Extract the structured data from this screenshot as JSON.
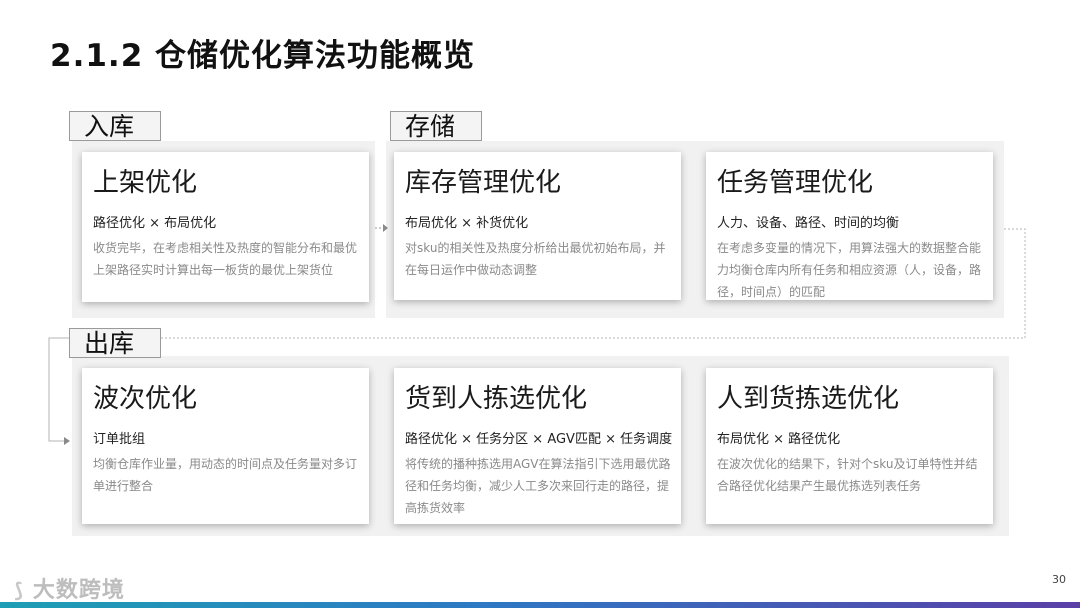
{
  "title": "2.1.2 仓储优化算法功能概览",
  "sections": {
    "inbound": "入库",
    "storage": "存储",
    "outbound": "出库"
  },
  "cards": {
    "putaway": {
      "title": "上架优化",
      "subtitle": "路径优化 × 布局优化",
      "desc": "收货完毕，在考虑相关性及热度的智能分布和最优上架路径实时计算出每一板货的最优上架货位"
    },
    "inventory": {
      "title": "库存管理优化",
      "subtitle": "布局优化 × 补货优化",
      "desc": "对sku的相关性及热度分析给出最优初始布局，并在每日运作中做动态调整"
    },
    "task": {
      "title": "任务管理优化",
      "subtitle": "人力、设备、路径、时间的均衡",
      "desc": "在考虑多变量的情况下，用算法强大的数据整合能力均衡仓库内所有任务和相应资源（人，设备，路径，时间点）的匹配"
    },
    "wave": {
      "title": "波次优化",
      "subtitle": "订单批组",
      "desc": "均衡仓库作业量，用动态的时间点及任务量对多订单进行整合"
    },
    "g2p": {
      "title": "货到人拣选优化",
      "subtitle": "路径优化 × 任务分区 × AGV匹配 × 任务调度",
      "desc": "将传统的播种拣选用AGV在算法指引下选用最优路径和任务均衡，减少人工多次来回行走的路径，提高拣货效率"
    },
    "p2g": {
      "title": "人到货拣选优化",
      "subtitle": "布局优化 × 路径优化",
      "desc": "在波次优化的结果下，针对个sku及订单特性并结合路径优化结果产生最优拣选列表任务"
    }
  },
  "footer": {
    "logo_text": "大数跨境",
    "page_number": "30"
  }
}
